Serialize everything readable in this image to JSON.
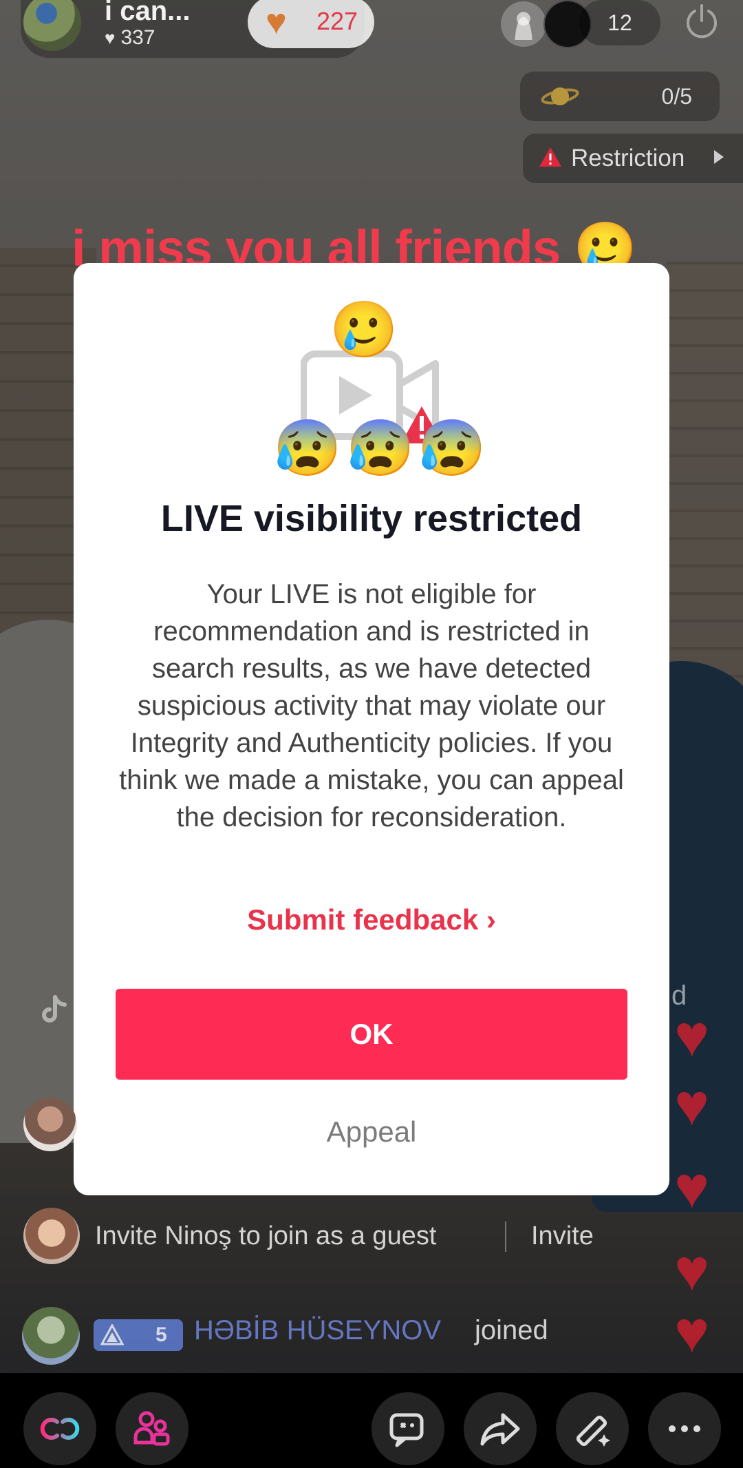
{
  "host": {
    "name": "i can...",
    "likes": "337",
    "gift_count": "227"
  },
  "viewers": {
    "count": "12"
  },
  "goal": {
    "progress": "0/5",
    "fraction": 0
  },
  "restriction": {
    "label": "Restriction"
  },
  "banner": {
    "text": "i miss you all friends 🥲"
  },
  "modal": {
    "emoji_top": "🥲",
    "emoji_row": [
      "😰",
      "😰",
      "😰"
    ],
    "title": "LIVE visibility restricted",
    "body": "Your LIVE is not eligible for recommendation and is restricted in search results, as we have detected suspicious activity that may violate our Integrity and Authenticity policies. If you think we made a mistake, you can appeal the decision for reconsideration.",
    "feedback_link": "Submit feedback ›",
    "ok_label": "OK",
    "appeal_label": "Appeal"
  },
  "comments": {
    "invite_text": "Invite Ninoş to join as a guest",
    "invite_button": "Invite",
    "joined_level": "5",
    "joined_name": "HƏBİB HÜSEYNOV",
    "joined_text": "joined",
    "side_letter": "d"
  },
  "colors": {
    "accent": "#fe2c55",
    "link": "#e8334b",
    "banner": "#f03b4d",
    "heart": "#c8202f",
    "level_badge": "#5c78c9"
  },
  "icons": {
    "toolbar": [
      "link-icon",
      "guests-icon",
      "gift-box-icon",
      "share-icon",
      "magic-wand-icon",
      "more-icon"
    ]
  }
}
